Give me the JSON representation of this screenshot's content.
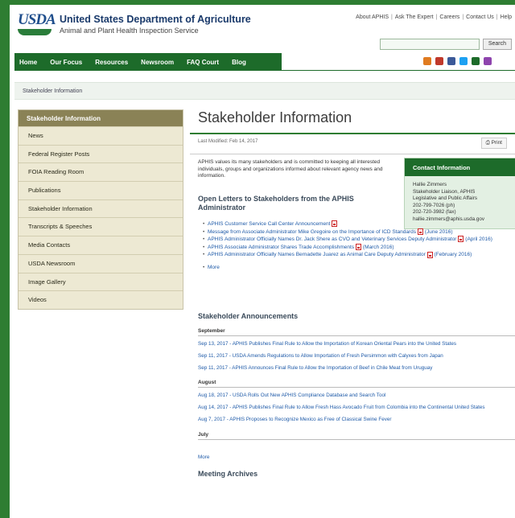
{
  "header": {
    "logo_text": "USDA",
    "agency_name": "United States Department of Agriculture",
    "agency_sub": "Animal and Plant Health Inspection Service",
    "util_links": [
      "About APHIS",
      "Ask The Expert",
      "Careers",
      "Contact Us",
      "Help"
    ],
    "search_button": "Search",
    "search_placeholder": ""
  },
  "nav": {
    "items": [
      "Home",
      "Our Focus",
      "Resources",
      "Newsroom",
      "FAQ Court",
      "Blog"
    ]
  },
  "social_colors": [
    "#e07b20",
    "#c0392b",
    "#3b5998",
    "#1da1f2",
    "#1d6b2a",
    "#8e44ad"
  ],
  "breadcrumb": "Stakeholder Information",
  "sidebar": {
    "heading": "Stakeholder Information",
    "items": [
      "News",
      "Federal Register Posts",
      "FOIA Reading Room",
      "Publications",
      "Stakeholder Information",
      "Transcripts & Speeches",
      "Media Contacts",
      "USDA Newsroom",
      "Image Gallery",
      "Videos"
    ]
  },
  "main": {
    "title": "Stakeholder Information",
    "last_modified": "Last Modified: Feb 14, 2017",
    "print_label": "Print",
    "intro": "APHIS values its many stakeholders and is committed to keeping all interested individuals, groups and organizations informed about relevant agency news and information.",
    "contact": {
      "heading": "Contact Information",
      "lines": [
        "Hallie Zimmers",
        "Stakeholder Liaison, APHIS",
        "Legislative and Public Affairs",
        "202-799-7026 (ph)",
        "202-720-3982 (fax)",
        "hallie.zimmers@aphis.usda.gov"
      ]
    },
    "open_letters_heading": "Open Letters to Stakeholders from the APHIS Administrator",
    "open_letters": [
      {
        "text": "APHIS Customer Service Call Center Announcement",
        "pdf": true
      },
      {
        "text": "Message from Associate Administrator Mike Gregoire on the Importance of ICD Standards",
        "pdf": true,
        "suffix": "(June 2016)"
      },
      {
        "text": "APHIS Administrator Officially Names Dr. Jack Shere as CVO and Veterinary Services Deputy Administrator",
        "pdf": true,
        "suffix": "(April 2016)"
      },
      {
        "text": "APHIS Associate Administrator Shares Trade Accomplishments",
        "pdf": true,
        "suffix": "(March 2016)"
      },
      {
        "text": "APHIS Administrator Officially Names Bernadette Juarez as Animal Care Deputy Administrator",
        "pdf": true,
        "suffix": "(February 2016)"
      }
    ],
    "more_label": "More",
    "announcements_heading": "Stakeholder Announcements",
    "months": [
      {
        "name": "September",
        "items": [
          "Sep 13, 2017 - APHIS Publishes Final Rule to Allow the Importation of Korean Oriental Pears into the United States",
          "Sep 11, 2017 - USDA Amends Regulations to Allow Importation of Fresh Persimmon with Calyxes from Japan",
          "Sep 11, 2017 - APHIS Announces Final Rule to Allow the Importation of Beef in Chile Meat from Uruguay"
        ]
      },
      {
        "name": "August",
        "items": [
          "Aug 18, 2017 - USDA Rolls Out New APHIS Compliance Database and Search Tool",
          "Aug 14, 2017 - APHIS Publishes Final Rule to Allow Fresh Hass Avocado Fruit from Colombia into the Continental United States",
          "Aug 7, 2017 - APHIS Proposes to Recognize Mexico as Free of Classical Swine Fever"
        ]
      },
      {
        "name": "July",
        "items": []
      }
    ],
    "meeting_heading": "Meeting Archives"
  }
}
